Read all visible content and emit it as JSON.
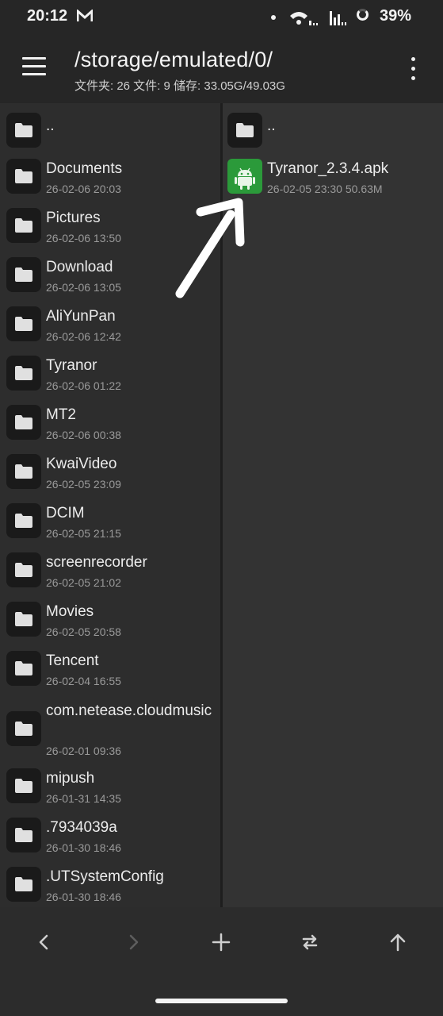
{
  "status": {
    "time": "20:12",
    "battery": "39%"
  },
  "header": {
    "path": "/storage/emulated/0/",
    "summary": "文件夹: 26  文件: 9  储存: 33.05G/49.03G"
  },
  "left_pane": {
    "parent": "..",
    "items": [
      {
        "name": "Documents",
        "meta": "26-02-06 20:03"
      },
      {
        "name": "Pictures",
        "meta": "26-02-06 13:50"
      },
      {
        "name": "Download",
        "meta": "26-02-06 13:05"
      },
      {
        "name": "AliYunPan",
        "meta": "26-02-06 12:42"
      },
      {
        "name": "Tyranor",
        "meta": "26-02-06 01:22"
      },
      {
        "name": "MT2",
        "meta": "26-02-06 00:38"
      },
      {
        "name": "KwaiVideo",
        "meta": "26-02-05 23:09"
      },
      {
        "name": "DCIM",
        "meta": "26-02-05 21:15"
      },
      {
        "name": "screenrecorder",
        "meta": "26-02-05 21:02"
      },
      {
        "name": "Movies",
        "meta": "26-02-05 20:58"
      },
      {
        "name": "Tencent",
        "meta": "26-02-04 16:55"
      },
      {
        "name": "com.netease.cloudmusic",
        "meta": "26-02-01 09:36"
      },
      {
        "name": "mipush",
        "meta": "26-01-31 14:35"
      },
      {
        "name": ".7934039a",
        "meta": "26-01-30 18:46"
      },
      {
        "name": ".UTSystemConfig",
        "meta": "26-01-30 18:46"
      }
    ]
  },
  "right_pane": {
    "parent": "..",
    "file": {
      "name": "Tyranor_2.3.4.apk",
      "meta": "26-02-05 23:30  50.63M",
      "icon": "android-icon"
    }
  },
  "toolbar": {
    "icons": [
      "back-icon",
      "forward-icon",
      "add-icon",
      "swap-icon",
      "up-icon"
    ]
  },
  "colors": {
    "apk_green": "#2b9a3a",
    "background": "#262626"
  }
}
